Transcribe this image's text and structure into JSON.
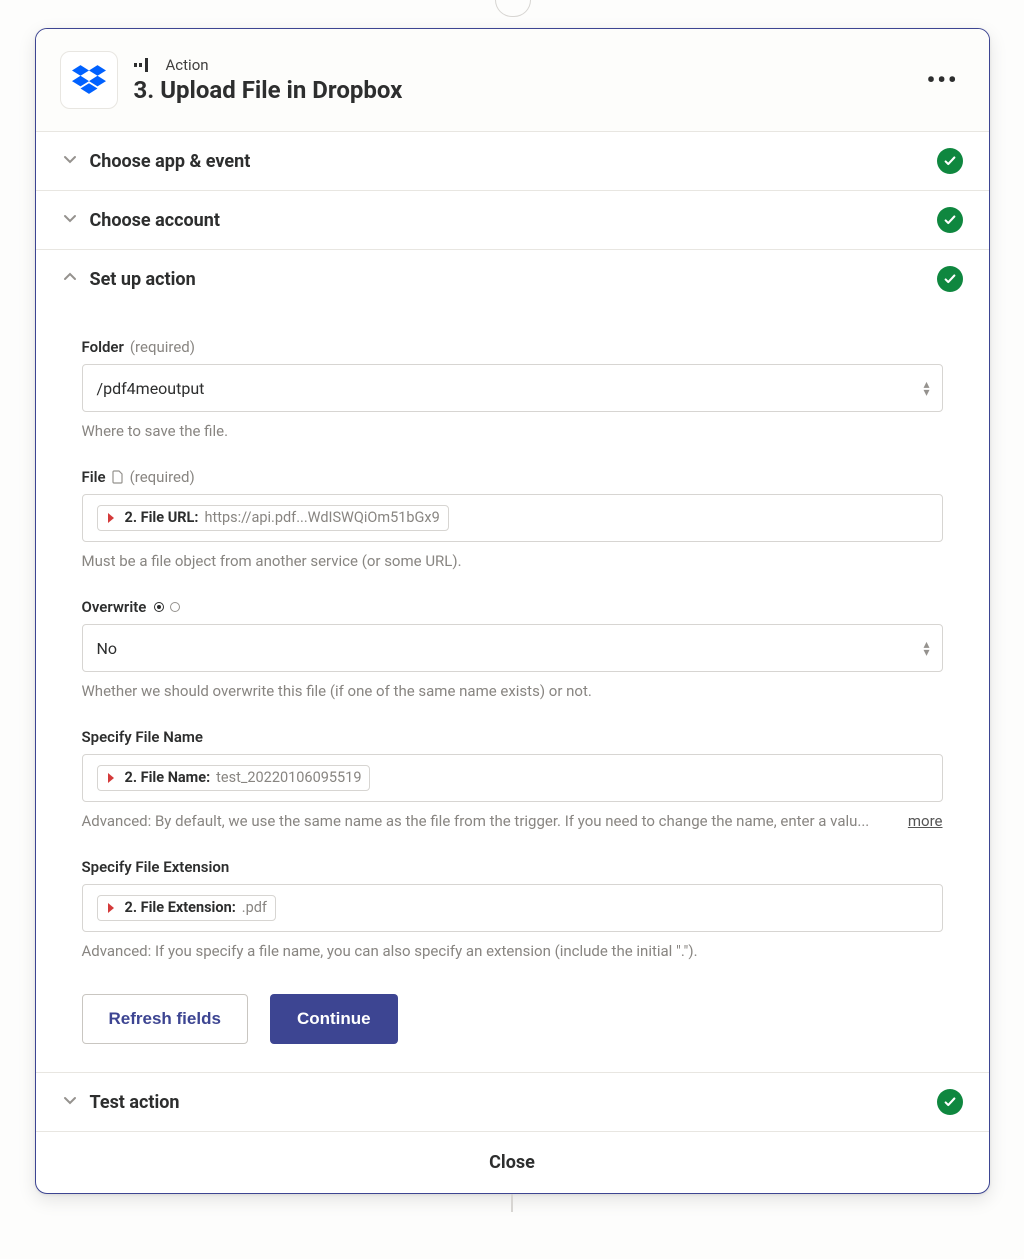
{
  "header": {
    "kicker": "Action",
    "title": "3. Upload File in Dropbox"
  },
  "sections": {
    "choose_app": "Choose app & event",
    "choose_account": "Choose account",
    "setup": "Set up action",
    "test": "Test action"
  },
  "fields": {
    "folder": {
      "label": "Folder",
      "required": "(required)",
      "value": "/pdf4meoutput",
      "help": "Where to save the file."
    },
    "file": {
      "label": "File",
      "required": "(required)",
      "pill_label": "2. File URL:",
      "pill_value": "https://api.pdf...WdISWQiOm51bGx9",
      "help": "Must be a file object from another service (or some URL)."
    },
    "overwrite": {
      "label": "Overwrite",
      "value": "No",
      "help": "Whether we should overwrite this file (if one of the same name exists) or not."
    },
    "filename": {
      "label": "Specify File Name",
      "pill_label": "2. File Name:",
      "pill_value": "test_20220106095519",
      "help": "Advanced: By default, we use the same name as the file from the trigger. If you need to change the name, enter a valu...",
      "more": "more"
    },
    "fileext": {
      "label": "Specify File Extension",
      "pill_label": "2. File Extension:",
      "pill_value": ".pdf",
      "help": "Advanced: If you specify a file name, you can also specify an extension (include the initial \".\")."
    }
  },
  "buttons": {
    "refresh": "Refresh fields",
    "continue": "Continue",
    "close": "Close"
  }
}
